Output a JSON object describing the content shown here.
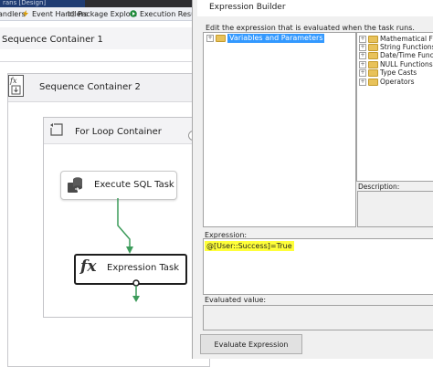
{
  "designer": {
    "doc_tab": "rans [Design]",
    "tabs": [
      {
        "label": "Handlers",
        "icon": "grid-icon"
      },
      {
        "label": "Event Handlers",
        "icon": "lightning-icon"
      },
      {
        "label": "Package Explo...",
        "icon": "explorer-icon"
      },
      {
        "label": "Execution Resu...",
        "icon": "play-icon"
      }
    ],
    "sequence_container_1": "Sequence Container 1",
    "sequence_container_2": "Sequence Container 2",
    "for_loop_container": "For Loop Container",
    "execute_sql_task": "Execute SQL Task",
    "expression_task": "Expression Task",
    "expression_task_icon": "fx"
  },
  "dialog": {
    "title": "Expression Builder",
    "instruction": "Edit the expression that is evaluated when the task runs.",
    "variables_node": "Variables and Parameters",
    "function_nodes": [
      "Mathematical Functi",
      "String Functions",
      "Date/Time Function",
      "NULL Functions",
      "Type Casts",
      "Operators"
    ],
    "description_label": "Description:",
    "expression_label": "Expression:",
    "expression_value": "@[User::Success]=True",
    "evaluated_label": "Evaluated value:",
    "evaluate_button": "Evaluate Expression"
  },
  "colors": {
    "highlight_yellow": "#ffff3a",
    "selection_blue": "#3399ff",
    "connector_green": "#3c9b5a",
    "doc_tab_blue": "#1f3c73"
  }
}
